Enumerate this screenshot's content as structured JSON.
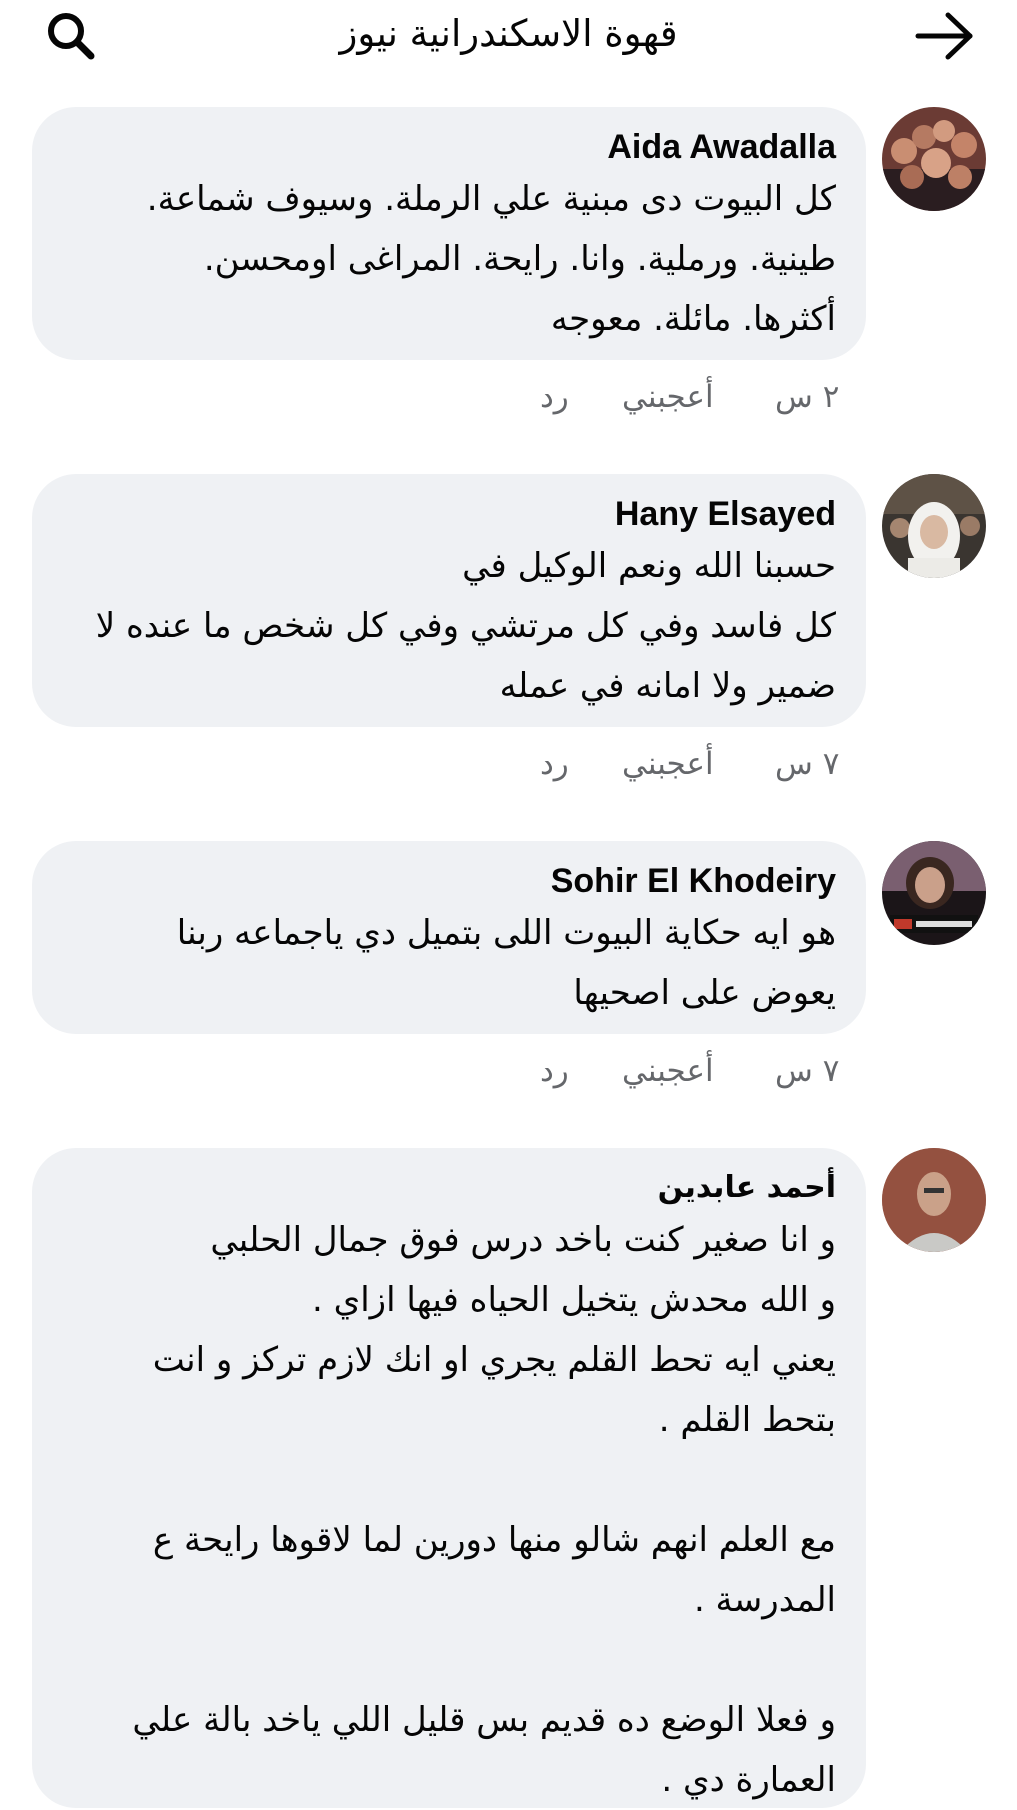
{
  "header": {
    "title": "قهوة الاسكندرانية نيوز"
  },
  "comments": [
    {
      "author": "Aida Awadalla",
      "text": "كل البيوت دى مبنية علي الرملة.  وسيوف شماعة.\nطينية. ورملية. وانا. رايحة.  المراغى اومحسن.\nأكثرها.  مائلة. معوجه",
      "time": "٢ س",
      "like": "أعجبني",
      "reply": "رد"
    },
    {
      "author": "Hany Elsayed",
      "text": "حسبنا الله ونعم الوكيل في\nكل فاسد وفي كل مرتشي وفي كل شخص ما عنده لا\nضمير ولا امانه في عمله",
      "time": "٧ س",
      "like": "أعجبني",
      "reply": "رد"
    },
    {
      "author": "Sohir El Khodeiry",
      "text": "هو ايه حكاية البيوت اللى بتميل دي ياجماعه ربنا\nيعوض على اصحيها",
      "time": "٧ س",
      "like": "أعجبني",
      "reply": "رد"
    },
    {
      "author": "أحمد عابدين",
      "text": "و انا صغير كنت باخد درس فوق جمال الحلبي\nو الله محدش يتخيل الحياه فيها ازاي .\nيعني ايه تحط القلم يجري او انك لازم تركز و انت\nبتحط القلم .\n\nمع العلم انهم شالو منها دورين لما لاقوها رايحة ع\nالمدرسة .\n\nو فعلا الوضع ده قديم بس قليل اللي ياخد بالة علي\nالعمارة دي ."
    }
  ]
}
